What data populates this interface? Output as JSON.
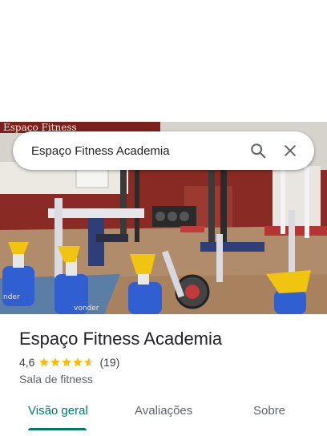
{
  "search": {
    "query": "Espaço Fitness Academia"
  },
  "photo": {
    "wall_sign": "Espaço Fitness",
    "bottle_brand_left": "nder",
    "bottle_brand_right": "vonder"
  },
  "place": {
    "name": "Espaço Fitness Academia",
    "rating": "4,6",
    "rating_fraction": 0.92,
    "review_count": "(19)",
    "category": "Sala de fitness"
  },
  "tabs": [
    {
      "label": "Visão geral",
      "active": true
    },
    {
      "label": "Avaliações",
      "active": false
    },
    {
      "label": "Sobre",
      "active": false
    }
  ],
  "colors": {
    "accent": "#00796b",
    "star": "#fbbc04",
    "star_empty": "#dadce0"
  },
  "icons": {
    "search": "search-icon",
    "clear": "close-icon"
  }
}
